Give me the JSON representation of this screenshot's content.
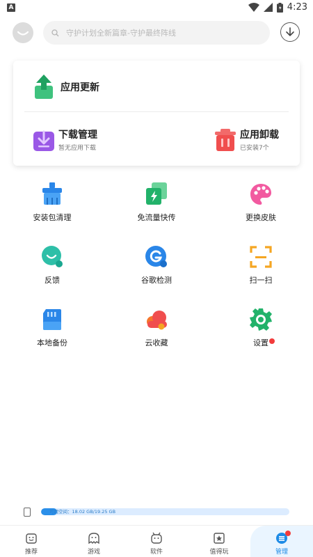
{
  "status_bar": {
    "app_icon_letter": "A",
    "time": "4:23"
  },
  "header": {
    "search_placeholder": "守护计划全新篇章-守护最终阵线"
  },
  "card": {
    "update": {
      "label": "应用更新"
    },
    "download": {
      "title": "下载管理",
      "subtitle": "暂无应用下载"
    },
    "uninstall": {
      "title": "应用卸载",
      "subtitle": "已安装7个"
    }
  },
  "tools": [
    {
      "label": "安装包清理",
      "icon": "broom-package-icon"
    },
    {
      "label": "免流量快传",
      "icon": "fast-transfer-icon"
    },
    {
      "label": "更换皮肤",
      "icon": "palette-icon"
    },
    {
      "label": "反馈",
      "icon": "feedback-bubble-icon"
    },
    {
      "label": "谷歌检测",
      "icon": "google-check-icon"
    },
    {
      "label": "扫一扫",
      "icon": "scan-icon"
    },
    {
      "label": "本地备份",
      "icon": "sd-card-backup-icon"
    },
    {
      "label": "云收藏",
      "icon": "cloud-favorite-icon"
    },
    {
      "label": "设置",
      "icon": "gear-icon"
    }
  ],
  "storage": {
    "text": "可用空间：18.02 GB/19.25 GB",
    "used_fraction": 0.064
  },
  "nav": [
    {
      "label": "推荐",
      "active": false
    },
    {
      "label": "游戏",
      "active": false
    },
    {
      "label": "软件",
      "active": false
    },
    {
      "label": "值得玩",
      "active": false
    },
    {
      "label": "管理",
      "active": true
    }
  ],
  "colors": {
    "accent": "#1e8be6",
    "badge": "#f23b3b"
  }
}
